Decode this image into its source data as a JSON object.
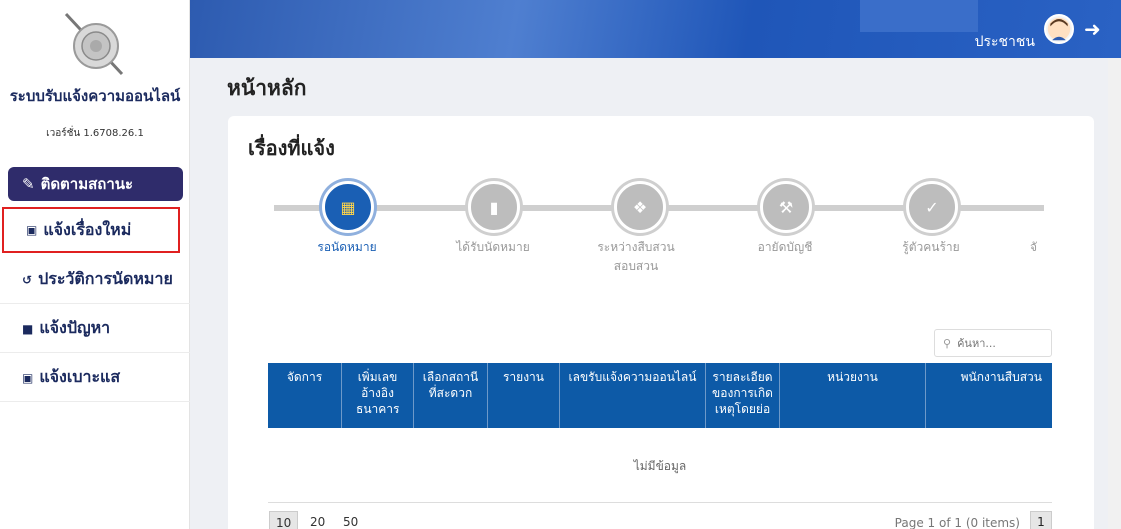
{
  "app": {
    "title": "ระบบรับแจ้งความออนไลน์",
    "version": "เวอร์ชั่น 1.6708.26.1"
  },
  "sidebar": {
    "primary_label": "ติดตามสถานะ",
    "items": [
      {
        "label": "แจ้งเรื่องใหม่",
        "icon": "folder-plus-icon"
      },
      {
        "label": "ประวัติการนัดหมาย",
        "icon": "history-icon"
      },
      {
        "label": "แจ้งปัญหา",
        "icon": "folder-icon"
      },
      {
        "label": "แจ้งเบาะแส",
        "icon": "folder-plus-icon"
      }
    ]
  },
  "header": {
    "user_label": "ประชาชน"
  },
  "main": {
    "page_title": "หน้าหลัก",
    "card_title": "เรื่องที่แจ้ง",
    "steps": [
      {
        "label": "รอนัดหมาย",
        "icon": "calendar-icon",
        "active": true
      },
      {
        "label": "ได้รับนัดหมาย",
        "icon": "briefcase-icon",
        "active": false
      },
      {
        "label": "ระหว่างสืบสวน สอบสวน",
        "icon": "handshake-icon",
        "active": false
      },
      {
        "label": "อายัดบัญชี",
        "icon": "gavel-icon",
        "active": false
      },
      {
        "label": "รู้ตัวคนร้าย",
        "icon": "check-icon",
        "active": false
      },
      {
        "label": "จั",
        "icon": "",
        "active": false
      }
    ],
    "search_placeholder": "ค้นหา...",
    "table": {
      "headers": [
        "จัดการ",
        "เพิ่มเลขอ้างอิงธนาคาร",
        "เลือกสถานีที่สะดวก",
        "รายงาน",
        "เลขรับแจ้งความออนไลน์",
        "รายละเอียดของการเกิดเหตุโดยย่อ",
        "หน่วยงาน",
        "พนักงานสืบสวน"
      ],
      "empty_text": "ไม่มีข้อมูล"
    },
    "pagination": {
      "sizes": [
        "10",
        "20",
        "50"
      ],
      "info": "Page 1 of 1 (0 items)",
      "current_page": "1"
    }
  },
  "colors": {
    "sidebar_primary": "#2f2c6b",
    "header_blue": "#2d5bb0",
    "table_header": "#0d5aa7",
    "active_step": "#1a5fb4",
    "highlight_border": "#e02020"
  }
}
